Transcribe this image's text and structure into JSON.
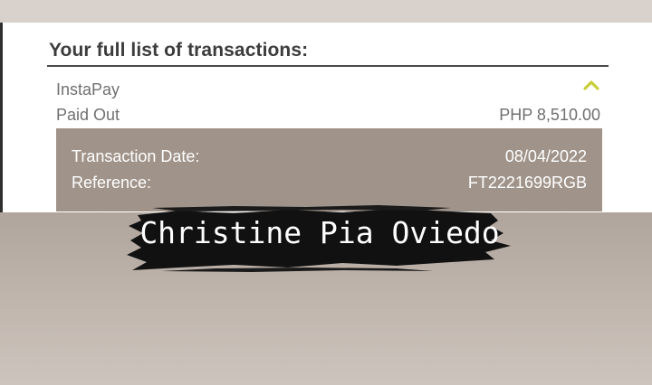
{
  "transactions": {
    "heading": "Your full list of transactions:",
    "item": {
      "name": "InstaPay",
      "type": "Paid Out",
      "amount": "PHP 8,510.00",
      "expand_icon": "chevron-up-icon",
      "details": {
        "date_label": "Transaction Date:",
        "date_value": "08/04/2022",
        "reference_label": "Reference:",
        "reference_value": "FT2221699RGB"
      }
    }
  },
  "overlay": {
    "caption": "Christine Pia Oviedo"
  },
  "colors": {
    "accent_chevron": "#c9cf3a",
    "details_background": "#a0948a",
    "brush_stroke": "#111111"
  }
}
